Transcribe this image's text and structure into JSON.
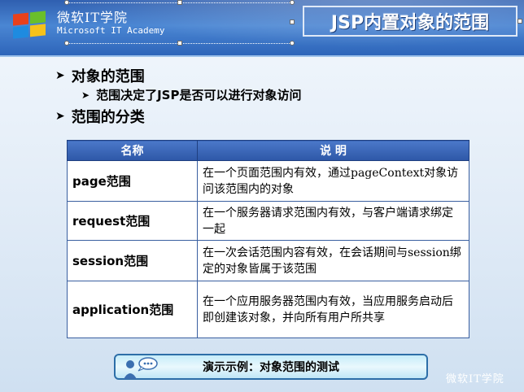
{
  "header": {
    "brand_cn": "微软IT学院",
    "brand_en": "Microsoft IT Academy",
    "title": "JSP内置对象的范围"
  },
  "bullets": {
    "level1_a": "对象的范围",
    "level2_a": "范围决定了JSP是否可以进行对象访问",
    "level1_b": "范围的分类"
  },
  "table": {
    "headers": [
      "名称",
      "说 明"
    ],
    "rows": [
      {
        "name": "page范围",
        "desc": "在一个页面范围内有效，通过pageContext对象访问该范围内的对象"
      },
      {
        "name": "request范围",
        "desc": "在一个服务器请求范围内有效，与客户端请求绑定一起"
      },
      {
        "name": "session范围",
        "desc": "在一次会话范围内容有效，在会话期间与session绑定的对象皆属于该范围"
      },
      {
        "name": "application范围",
        "desc": "在一个应用服务器范围内有效，当应用服务启动后即创建该对象，并向所有用户所共享"
      }
    ]
  },
  "demo": {
    "label": "演示示例：对象范围的测试",
    "icon": "presenter-speech-icon"
  },
  "footer": {
    "brand": "微软IT学院"
  },
  "colors": {
    "header_blue": "#2f5fb0",
    "table_header": "#2d57a7",
    "demo_border": "#2d6ea8"
  }
}
